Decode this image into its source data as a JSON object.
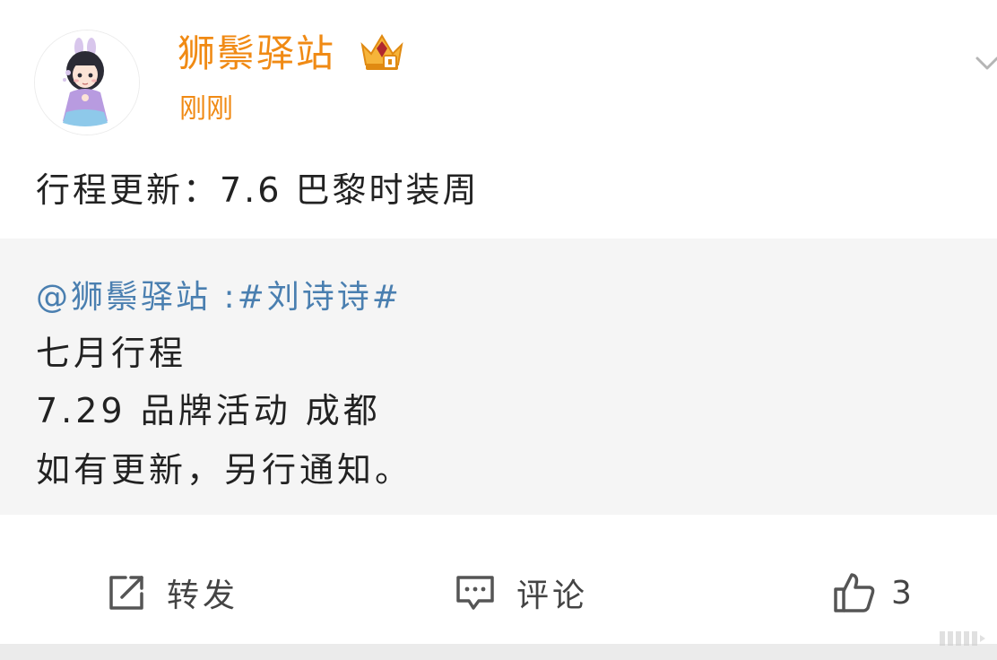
{
  "post": {
    "author": "狮鬃驿站",
    "time": "刚刚",
    "text": "行程更新：7.6 巴黎时装周"
  },
  "repost": {
    "mention": "@狮鬃驿站",
    "separator": " :",
    "hashtag": "#刘诗诗#",
    "lines": [
      "七月行程",
      "7.29 品牌活动 成都",
      "如有更新，另行通知。"
    ]
  },
  "actions": {
    "repost_label": "转发",
    "comment_label": "评论",
    "like_count": "3"
  },
  "icons": {
    "vip": "crown-badge-icon",
    "menu": "chevron-down-icon",
    "repost": "share-arrow-icon",
    "comment": "comment-bubble-icon",
    "like": "thumbs-up-icon"
  },
  "colors": {
    "username": "#f08a14",
    "link": "#4a7fb0",
    "repost_bg": "#f5f5f5"
  }
}
